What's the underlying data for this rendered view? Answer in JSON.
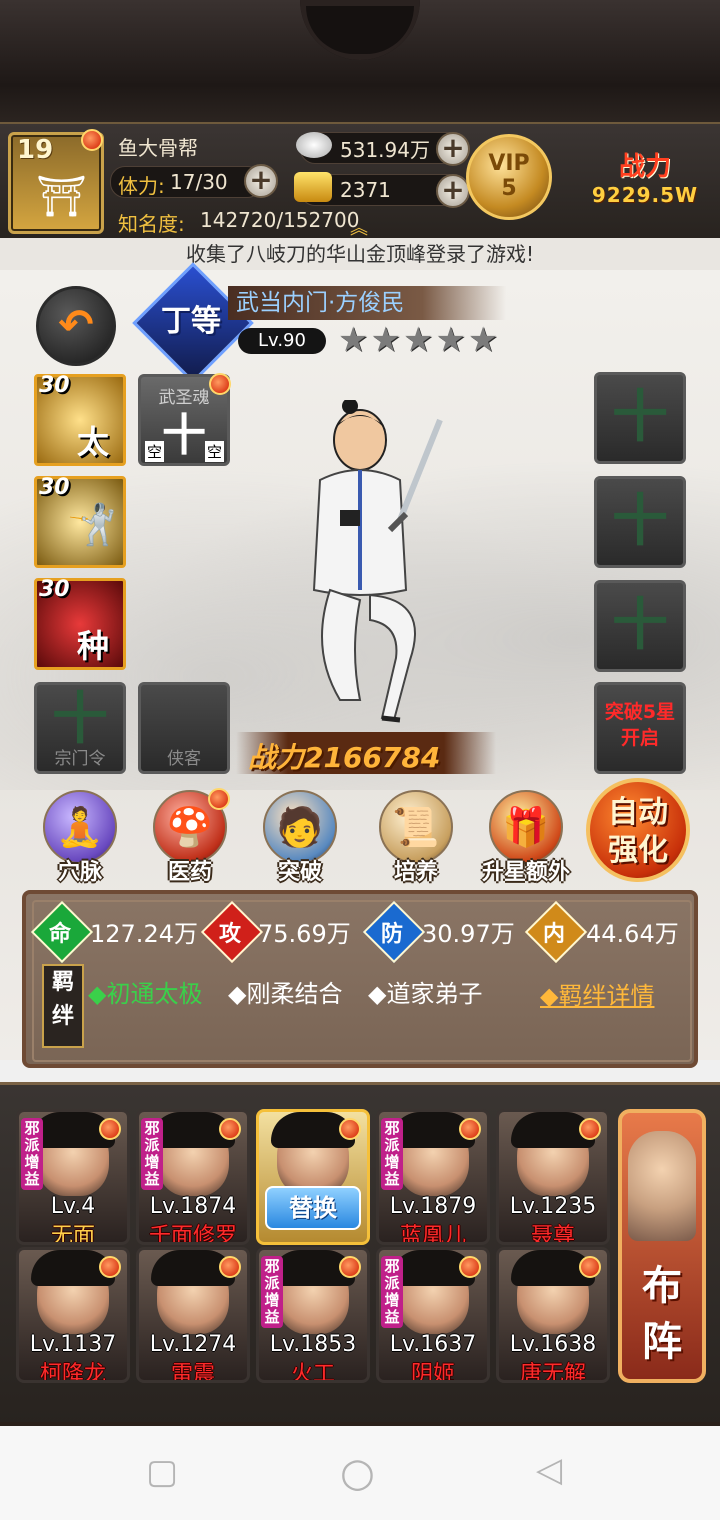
{
  "header": {
    "level": "19",
    "guild_name": "鱼大骨帮",
    "stamina_label": "体力:",
    "stamina_value": "17/30",
    "fame_label": "知名度:",
    "fame_value": "142720/152700",
    "silver": "531.94万",
    "gold": "2371",
    "vip_label": "VIP",
    "vip_level": "5",
    "power_label": "战力",
    "power_value": "9229.5W"
  },
  "notice": "收集了八岐刀的华山金顶峰登录了游戏!",
  "hero": {
    "rank": "丁等",
    "name": "武当内门·方俊民",
    "level": "Lv.90",
    "stars": "★★★★★",
    "star_count": 0,
    "power": "战力2166784"
  },
  "skills": [
    {
      "level": "30",
      "glyph": "太",
      "color": "#c8a030"
    },
    {
      "level": "30",
      "glyph": "",
      "color": "#8a6a1a"
    },
    {
      "level": "30",
      "glyph": "种",
      "color": "#b01a1a"
    }
  ],
  "soul_slot": {
    "title": "武圣魂",
    "left": "空",
    "right": "空"
  },
  "slots": {
    "sect_order": "宗门令",
    "retainer": "侠客",
    "breakthrough": "突破5星开启"
  },
  "functions": [
    {
      "label": "穴脉",
      "icon": "meridian-icon"
    },
    {
      "label": "医药",
      "icon": "medicine-icon"
    },
    {
      "label": "突破",
      "icon": "breakthrough-icon"
    },
    {
      "label": "培养",
      "icon": "training-icon"
    },
    {
      "label": "升星额外",
      "icon": "star-up-icon"
    }
  ],
  "auto_strengthen": {
    "line1": "自动",
    "line2": "强化"
  },
  "stats": [
    {
      "icon": "命",
      "value": "127.24万",
      "color": "#1aa83a"
    },
    {
      "icon": "攻",
      "value": "75.69万",
      "color": "#d0201a"
    },
    {
      "icon": "防",
      "value": "30.97万",
      "color": "#1a6ad0"
    },
    {
      "icon": "内",
      "value": "44.64万",
      "color": "#d08a1a"
    }
  ],
  "bonds": {
    "tag": "羁绊",
    "items": [
      "◆初通太极",
      "◆刚柔结合",
      "◆道家弟子"
    ],
    "details": "◆羁绊详情"
  },
  "formation": {
    "tag": "邪派增益",
    "replace": "替换",
    "lineup": {
      "line1": "布",
      "line2": "阵"
    },
    "members": [
      {
        "level": "Lv.4",
        "name": "无面",
        "tag": true,
        "name_color": "#ffd04a"
      },
      {
        "level": "Lv.1874",
        "name": "千面修罗",
        "tag": true,
        "name_color": "#ff2a2a"
      },
      {
        "level": "",
        "name": "",
        "tag": false,
        "name_color": "#ff2a2a",
        "selected": true
      },
      {
        "level": "Lv.1879",
        "name": "蓝凰儿",
        "tag": true,
        "name_color": "#ff2a2a"
      },
      {
        "level": "Lv.1235",
        "name": "聂尊",
        "tag": false,
        "name_color": "#ff2a2a"
      },
      {
        "level": "Lv.1137",
        "name": "柯降龙",
        "tag": false,
        "name_color": "#ff2a2a"
      },
      {
        "level": "Lv.1274",
        "name": "雷震",
        "tag": false,
        "name_color": "#ff2a2a"
      },
      {
        "level": "Lv.1853",
        "name": "火工",
        "tag": true,
        "name_color": "#ff2a2a"
      },
      {
        "level": "Lv.1637",
        "name": "阴姬",
        "tag": true,
        "name_color": "#ff2a2a"
      },
      {
        "level": "Lv.1638",
        "name": "唐无解",
        "tag": false,
        "name_color": "#ff2a2a"
      }
    ]
  },
  "navbar": {
    "square": "▢",
    "circle": "○",
    "back": "◁"
  }
}
